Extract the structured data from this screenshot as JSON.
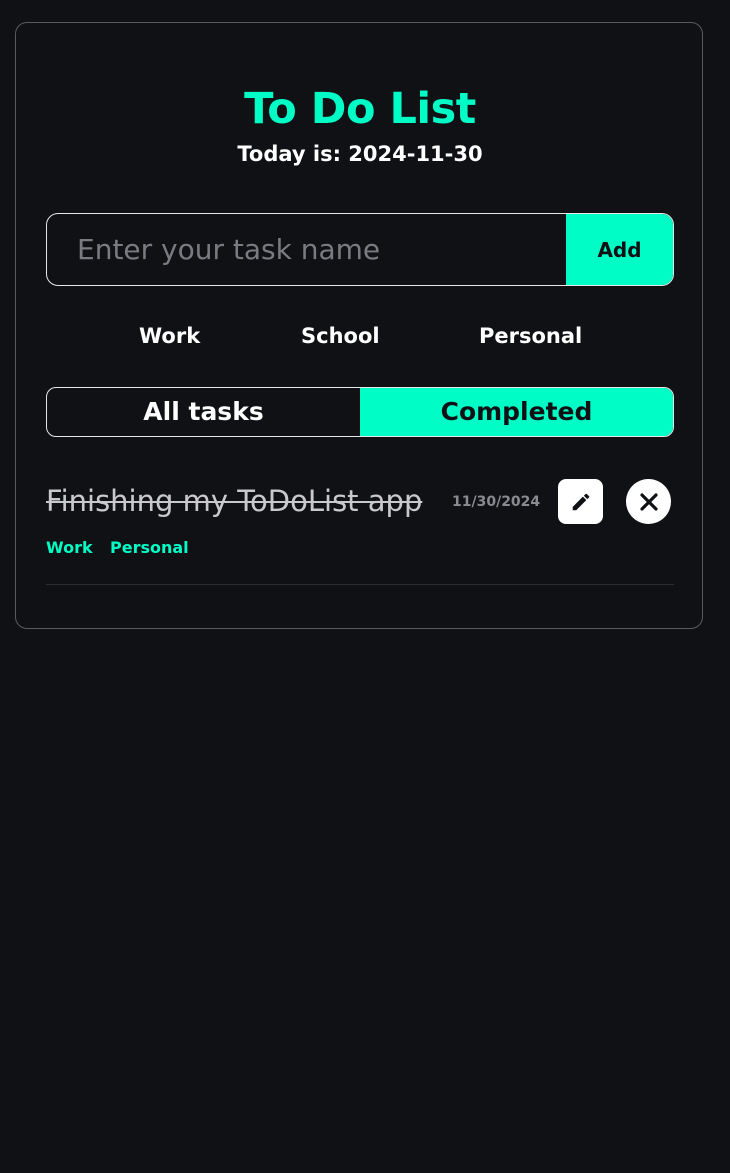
{
  "app": {
    "title": "To Do List",
    "today_text": "Today is: 2024-11-30"
  },
  "new_task": {
    "placeholder": "Enter your task name",
    "value": "",
    "add_label": "Add"
  },
  "categories": [
    "Work",
    "School",
    "Personal"
  ],
  "tabs": {
    "all_label": "All tasks",
    "completed_label": "Completed",
    "active": "Completed"
  },
  "tasks": [
    {
      "name": "Finishing my ToDoList app",
      "date": "11/30/2024",
      "completed": true,
      "tags": [
        "Work",
        "Personal"
      ],
      "edit_icon": "pencil-icon",
      "delete_icon": "close-icon"
    }
  ],
  "colors": {
    "accent": "#00fdc6",
    "background": "#101115",
    "border": "#e6e6e6",
    "muted_text": "#8a8b90"
  }
}
